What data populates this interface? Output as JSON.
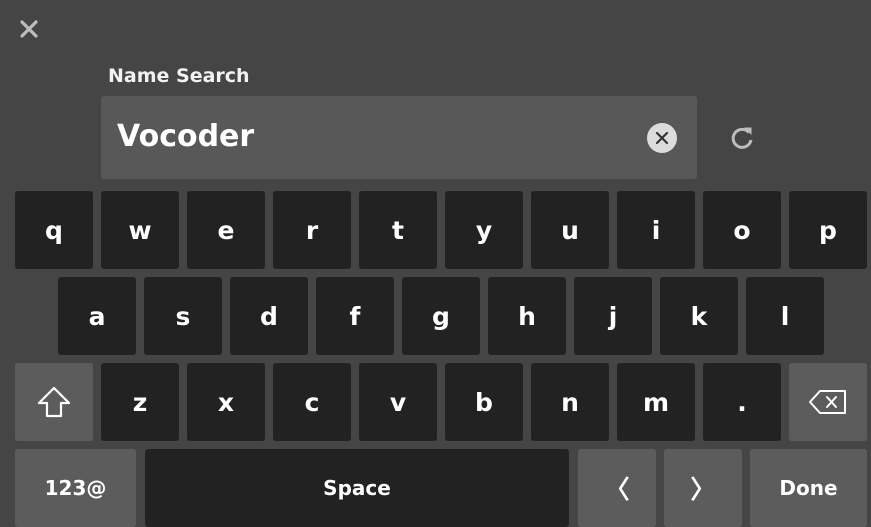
{
  "header": {
    "close_icon": "close-icon"
  },
  "search": {
    "label": "Name Search",
    "value": "Vocoder",
    "clear_icon": "clear-circle-icon",
    "refresh_icon": "refresh-icon"
  },
  "keyboard": {
    "row1": [
      "q",
      "w",
      "e",
      "r",
      "t",
      "y",
      "u",
      "i",
      "o",
      "p"
    ],
    "row2": [
      "a",
      "s",
      "d",
      "f",
      "g",
      "h",
      "j",
      "k",
      "l"
    ],
    "row3": [
      "z",
      "x",
      "c",
      "v",
      "b",
      "n",
      "m",
      "."
    ],
    "shift_icon": "shift-arrow-icon",
    "backspace_icon": "backspace-icon",
    "mode_label": "123@",
    "space_label": "Space",
    "left_label": "〈",
    "right_label": "〉",
    "done_label": "Done"
  },
  "colors": {
    "background": "#454545",
    "key": "#222222",
    "function_key": "#5c5c5c",
    "search_box": "#585858"
  }
}
